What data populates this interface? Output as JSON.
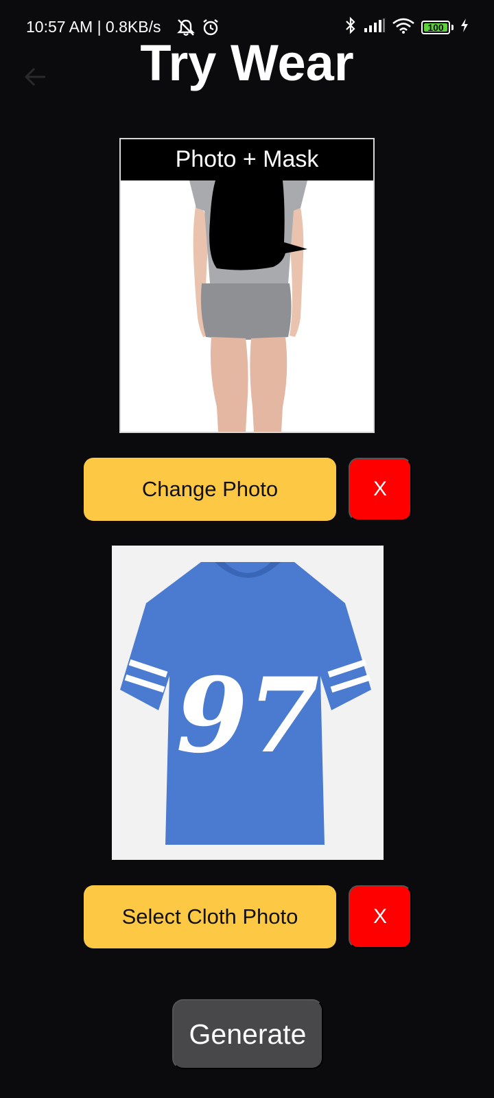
{
  "status_bar": {
    "time_text": "10:57 AM | 0.8KB/s",
    "battery_level": "100",
    "icons": [
      "mute-notifications-icon",
      "alarm-icon",
      "bluetooth-icon",
      "signal-icon",
      "wifi-icon",
      "battery-icon",
      "charging-icon"
    ]
  },
  "header": {
    "title": "Try Wear",
    "back_icon": "back-arrow-icon"
  },
  "photo_card": {
    "label": "Photo + Mask"
  },
  "photo_actions": {
    "change_label": "Change Photo",
    "remove_label": "X"
  },
  "cloth_card": {
    "jersey_number": "97"
  },
  "cloth_actions": {
    "select_label": "Select Cloth Photo",
    "remove_label": "X"
  },
  "generate": {
    "label": "Generate"
  },
  "colors": {
    "background": "#0b0b0d",
    "primary_button": "#fdc844",
    "remove_button": "#ff0000",
    "generate_button": "#48484a",
    "shirt": "#4a7bd0"
  }
}
